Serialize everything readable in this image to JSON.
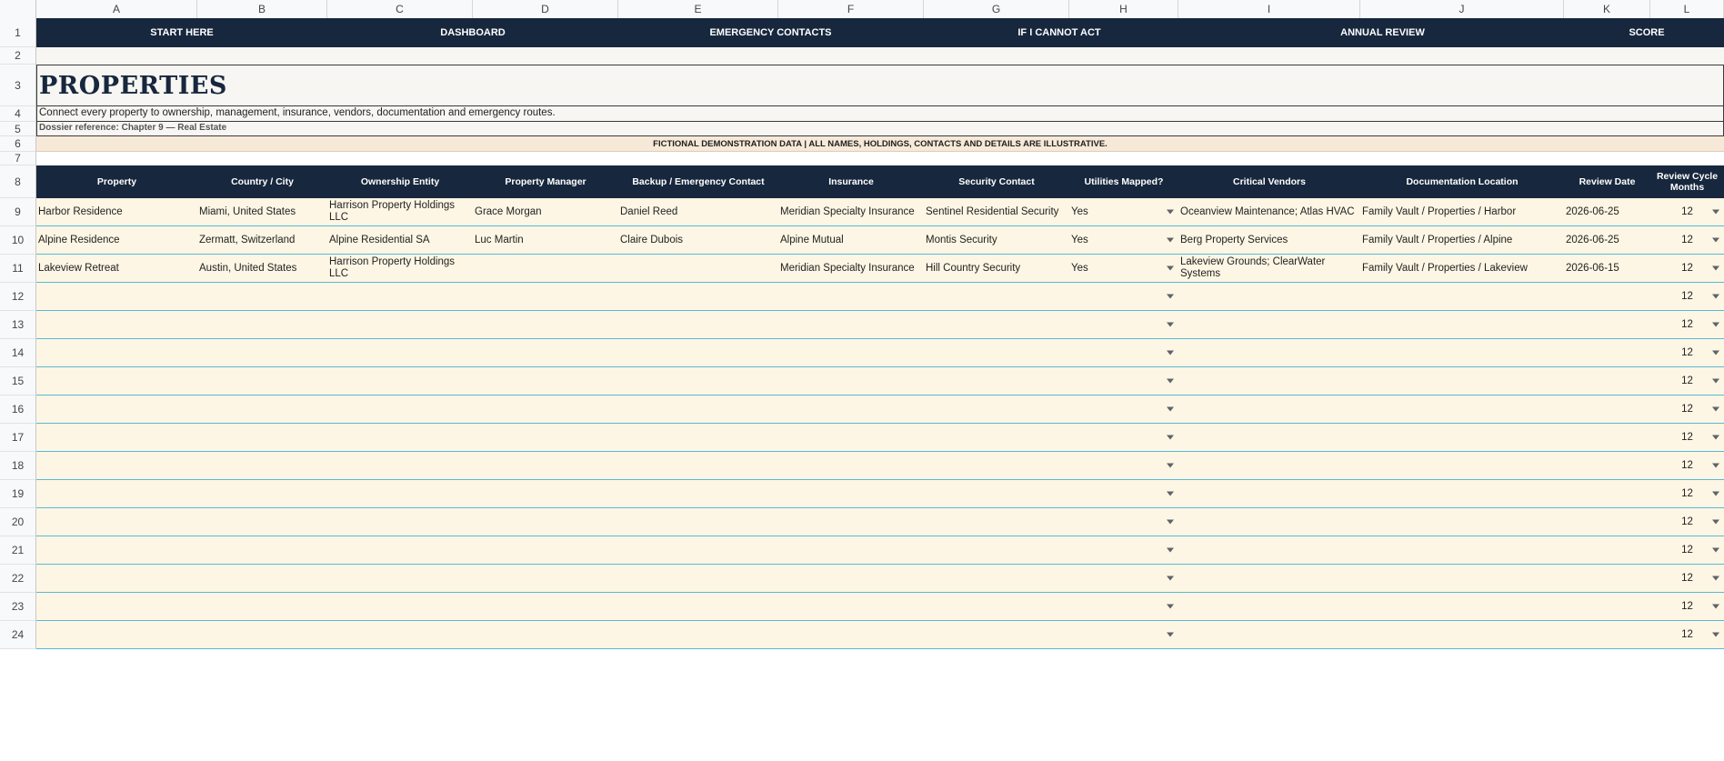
{
  "columns": [
    "A",
    "B",
    "C",
    "D",
    "E",
    "F",
    "G",
    "H",
    "I",
    "J",
    "K",
    "L"
  ],
  "row_numbers": [
    "1",
    "2",
    "3",
    "4",
    "5",
    "6",
    "7",
    "8",
    "9",
    "10",
    "11",
    "12",
    "13",
    "14",
    "15",
    "16",
    "17",
    "18",
    "19",
    "20",
    "21",
    "22",
    "23",
    "24"
  ],
  "nav": [
    "START HERE",
    "DASHBOARD",
    "EMERGENCY CONTACTS",
    "IF I CANNOT ACT",
    "ANNUAL REVIEW",
    "SCORE"
  ],
  "title": "PROPERTIES",
  "subtitle": "Connect every property to ownership, management, insurance, vendors, documentation and emergency routes.",
  "reference": "Dossier reference: Chapter 9 — Real Estate",
  "notice": "FICTIONAL DEMONSTRATION DATA | ALL NAMES, HOLDINGS, CONTACTS AND DETAILS ARE ILLUSTRATIVE.",
  "table_headers": [
    "Property",
    "Country / City",
    "Ownership Entity",
    "Property Manager",
    "Backup / Emergency Contact",
    "Insurance",
    "Security Contact",
    "Utilities Mapped?",
    "Critical Vendors",
    "Documentation Location",
    "Review Date",
    "Review Cycle Months"
  ],
  "rows": [
    [
      "Harbor Residence",
      "Miami, United States",
      "Harrison Property Holdings LLC",
      "Grace Morgan",
      "Daniel Reed",
      "Meridian Specialty Insurance",
      "Sentinel Residential Security",
      "Yes",
      "Oceanview Maintenance; Atlas HVAC",
      "Family Vault / Properties / Harbor",
      "2026-06-25",
      "12"
    ],
    [
      "Alpine Residence",
      "Zermatt, Switzerland",
      "Alpine Residential SA",
      "Luc Martin",
      "Claire Dubois",
      "Alpine Mutual",
      "Montis Security",
      "Yes",
      "Berg Property Services",
      "Family Vault / Properties / Alpine",
      "2026-06-25",
      "12"
    ],
    [
      "Lakeview Retreat",
      "Austin, United States",
      "Harrison Property Holdings LLC",
      "",
      "",
      "Meridian Specialty Insurance",
      "Hill Country Security",
      "Yes",
      "Lakeview Grounds; ClearWater Systems",
      "Family Vault / Properties / Lakeview",
      "2026-06-15",
      "12"
    ],
    [
      "",
      "",
      "",
      "",
      "",
      "",
      "",
      "",
      "",
      "",
      "",
      "12"
    ],
    [
      "",
      "",
      "",
      "",
      "",
      "",
      "",
      "",
      "",
      "",
      "",
      "12"
    ],
    [
      "",
      "",
      "",
      "",
      "",
      "",
      "",
      "",
      "",
      "",
      "",
      "12"
    ],
    [
      "",
      "",
      "",
      "",
      "",
      "",
      "",
      "",
      "",
      "",
      "",
      "12"
    ],
    [
      "",
      "",
      "",
      "",
      "",
      "",
      "",
      "",
      "",
      "",
      "",
      "12"
    ],
    [
      "",
      "",
      "",
      "",
      "",
      "",
      "",
      "",
      "",
      "",
      "",
      "12"
    ],
    [
      "",
      "",
      "",
      "",
      "",
      "",
      "",
      "",
      "",
      "",
      "",
      "12"
    ],
    [
      "",
      "",
      "",
      "",
      "",
      "",
      "",
      "",
      "",
      "",
      "",
      "12"
    ],
    [
      "",
      "",
      "",
      "",
      "",
      "",
      "",
      "",
      "",
      "",
      "",
      "12"
    ],
    [
      "",
      "",
      "",
      "",
      "",
      "",
      "",
      "",
      "",
      "",
      "",
      "12"
    ],
    [
      "",
      "",
      "",
      "",
      "",
      "",
      "",
      "",
      "",
      "",
      "",
      "12"
    ],
    [
      "",
      "",
      "",
      "",
      "",
      "",
      "",
      "",
      "",
      "",
      "",
      "12"
    ],
    [
      "",
      "",
      "",
      "",
      "",
      "",
      "",
      "",
      "",
      "",
      "",
      "12"
    ]
  ],
  "dropdown_icon": "chevron-down-icon"
}
